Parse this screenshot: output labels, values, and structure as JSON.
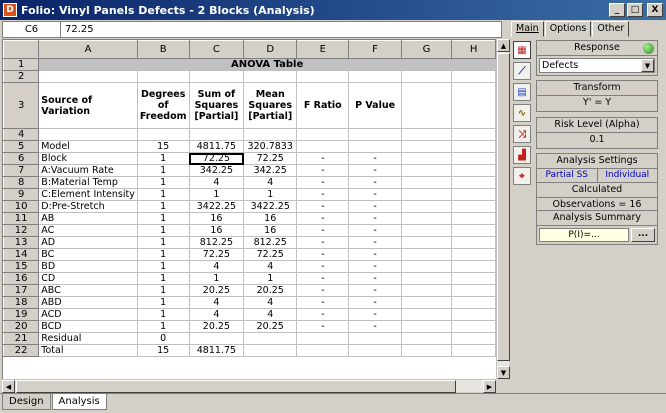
{
  "window": {
    "title": "Folio: Vinyl Panels Defects - 2 Blocks (Analysis)",
    "buttons": {
      "minimize": "_",
      "maximize": "□",
      "close": "X"
    }
  },
  "formula_bar": {
    "cell_ref": "C6",
    "value": "72.25"
  },
  "columns": [
    "A",
    "B",
    "C",
    "D",
    "E",
    "F",
    "G",
    "H"
  ],
  "table": {
    "title": "ANOVA Table",
    "headers": {
      "source": "Source of Variation",
      "df": "Degrees of Freedom",
      "ss": "Sum of Squares [Partial]",
      "ms": "Mean Squares [Partial]",
      "f": "F Ratio",
      "p": "P Value"
    },
    "rows": [
      {
        "n": "5",
        "source": "Model",
        "df": "15",
        "ss": "4811.75",
        "ms": "320.7833",
        "f": "",
        "p": "",
        "indent": 0
      },
      {
        "n": "6",
        "source": "Block",
        "df": "1",
        "ss": "72.25",
        "ms": "72.25",
        "f": "-",
        "p": "-",
        "indent": 1
      },
      {
        "n": "7",
        "source": "A:Vacuum Rate",
        "df": "1",
        "ss": "342.25",
        "ms": "342.25",
        "f": "-",
        "p": "-",
        "indent": 2
      },
      {
        "n": "8",
        "source": "B:Material Temp",
        "df": "1",
        "ss": "4",
        "ms": "4",
        "f": "-",
        "p": "-",
        "indent": 2
      },
      {
        "n": "9",
        "source": "C:Element Intensity",
        "df": "1",
        "ss": "1",
        "ms": "1",
        "f": "-",
        "p": "-",
        "indent": 2
      },
      {
        "n": "10",
        "source": "D:Pre-Stretch",
        "df": "1",
        "ss": "3422.25",
        "ms": "3422.25",
        "f": "-",
        "p": "-",
        "indent": 2
      },
      {
        "n": "11",
        "source": "AB",
        "df": "1",
        "ss": "16",
        "ms": "16",
        "f": "-",
        "p": "-",
        "indent": 2
      },
      {
        "n": "12",
        "source": "AC",
        "df": "1",
        "ss": "16",
        "ms": "16",
        "f": "-",
        "p": "-",
        "indent": 2
      },
      {
        "n": "13",
        "source": "AD",
        "df": "1",
        "ss": "812.25",
        "ms": "812.25",
        "f": "-",
        "p": "-",
        "indent": 2
      },
      {
        "n": "14",
        "source": "BC",
        "df": "1",
        "ss": "72.25",
        "ms": "72.25",
        "f": "-",
        "p": "-",
        "indent": 2
      },
      {
        "n": "15",
        "source": "BD",
        "df": "1",
        "ss": "4",
        "ms": "4",
        "f": "-",
        "p": "-",
        "indent": 2
      },
      {
        "n": "16",
        "source": "CD",
        "df": "1",
        "ss": "1",
        "ms": "1",
        "f": "-",
        "p": "-",
        "indent": 2
      },
      {
        "n": "17",
        "source": "ABC",
        "df": "1",
        "ss": "20.25",
        "ms": "20.25",
        "f": "-",
        "p": "-",
        "indent": 2
      },
      {
        "n": "18",
        "source": "ABD",
        "df": "1",
        "ss": "4",
        "ms": "4",
        "f": "-",
        "p": "-",
        "indent": 2
      },
      {
        "n": "19",
        "source": "ACD",
        "df": "1",
        "ss": "4",
        "ms": "4",
        "f": "-",
        "p": "-",
        "indent": 2
      },
      {
        "n": "20",
        "source": "BCD",
        "df": "1",
        "ss": "20.25",
        "ms": "20.25",
        "f": "-",
        "p": "-",
        "indent": 2
      },
      {
        "n": "21",
        "source": "Residual",
        "df": "0",
        "ss": "",
        "ms": "",
        "f": "",
        "p": "",
        "indent": 0
      },
      {
        "n": "22",
        "source": "Total",
        "df": "15",
        "ss": "4811.75",
        "ms": "",
        "f": "",
        "p": "",
        "indent": 0
      }
    ]
  },
  "sheet_tabs": [
    "Design",
    "Analysis"
  ],
  "panel": {
    "tabs": [
      "Main",
      "Options",
      "Other"
    ],
    "response": {
      "label": "Response",
      "value": "Defects"
    },
    "transform": {
      "label": "Transform",
      "value": "Y' = Y"
    },
    "risk": {
      "label": "Risk Level (Alpha)",
      "value": "0.1"
    },
    "settings": {
      "label": "Analysis Settings",
      "ss_type": "Partial SS",
      "mode": "Individual",
      "calculated": "Calculated",
      "observations": "Observations = 16"
    },
    "summary": {
      "label": "Analysis Summary",
      "value": "P(I)=...",
      "button": "..."
    },
    "tools": [
      "anova-icon",
      "scatter-plot-icon",
      "effects-icon",
      "residual-icon",
      "interaction-icon",
      "histogram-icon",
      "target-icon"
    ],
    "tool_glyphs": [
      "▦",
      "⟋",
      "▤",
      "∿",
      "⤨",
      "▟",
      "⌖"
    ]
  },
  "colors": {
    "accent": "#0a246a",
    "selection_text": "#0000c0",
    "summary_bg": "#ffffe1"
  }
}
